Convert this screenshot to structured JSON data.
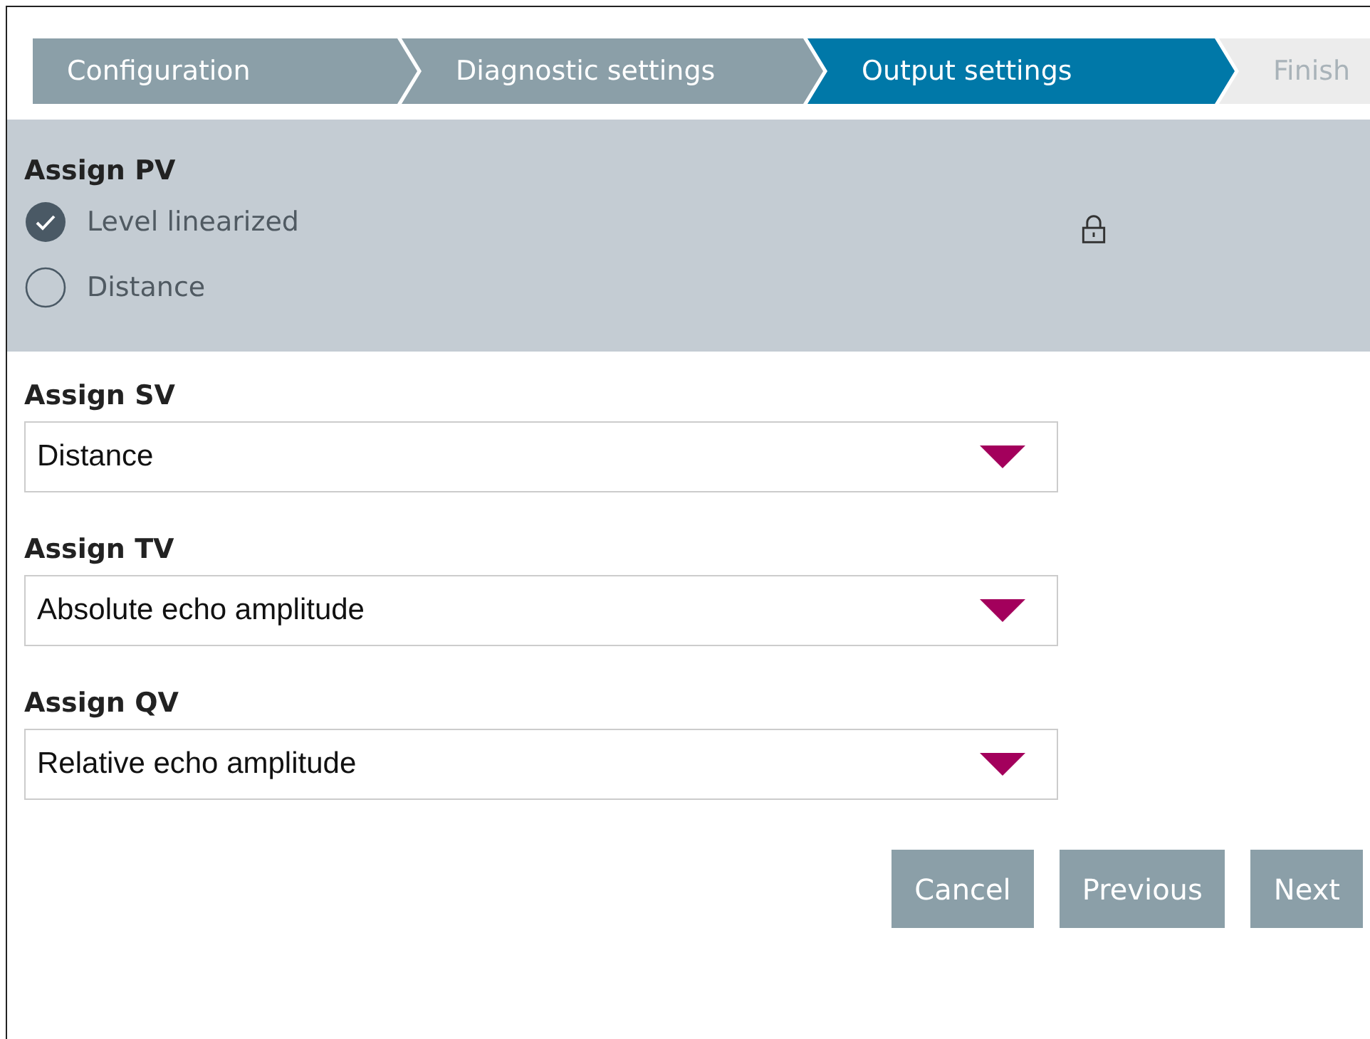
{
  "steps": [
    {
      "label": "Configuration",
      "completed": true,
      "selected": false
    },
    {
      "label": "Diagnostic settings",
      "completed": true,
      "selected": false
    },
    {
      "label": "Output settings",
      "completed": false,
      "selected": true
    },
    {
      "label": "Finish",
      "completed": false,
      "selected": false
    }
  ],
  "locked_section": {
    "locked": true,
    "label": "Assign PV",
    "options": [
      {
        "label": "Level linearized",
        "selected": true
      },
      {
        "label": "Distance",
        "selected": false
      }
    ]
  },
  "fields": [
    {
      "label": "Assign SV",
      "value": "Distance"
    },
    {
      "label": "Assign TV",
      "value": "Absolute echo amplitude"
    },
    {
      "label": "Assign QV",
      "value": "Relative echo amplitude"
    }
  ],
  "buttons": [
    {
      "label": "Cancel"
    },
    {
      "label": "Previous"
    },
    {
      "label": "Next"
    }
  ]
}
